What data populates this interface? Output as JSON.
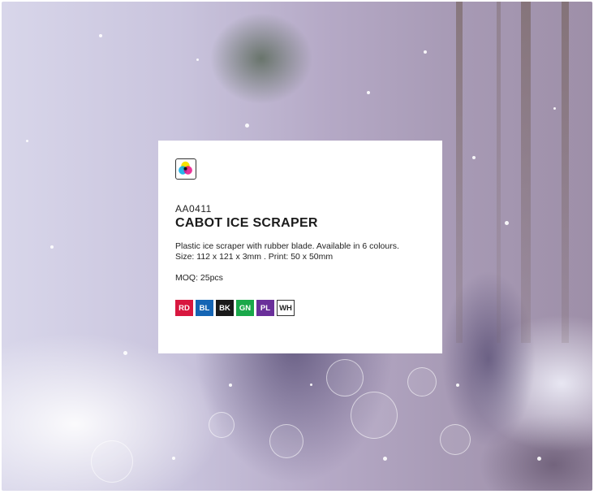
{
  "product": {
    "code": "AA0411",
    "name": "CABOT ICE SCRAPER",
    "description": "Plastic ice scraper with rubber blade. Available in 6 colours.",
    "size": "Size: 112 x 121 x 3mm . Print: 50 x 50mm",
    "moq": "MOQ: 25pcs",
    "icon": "cmyk-print-icon",
    "colours": [
      {
        "code": "RD",
        "color": "#d8173f",
        "text": "#ffffff"
      },
      {
        "code": "BL",
        "color": "#1565b4",
        "text": "#ffffff"
      },
      {
        "code": "BK",
        "color": "#1a1a1a",
        "text": "#ffffff"
      },
      {
        "code": "GN",
        "color": "#1aa84a",
        "text": "#ffffff"
      },
      {
        "code": "PL",
        "color": "#6a2f9a",
        "text": "#ffffff"
      },
      {
        "code": "WH",
        "color": "#ffffff",
        "text": "#222222"
      }
    ]
  }
}
